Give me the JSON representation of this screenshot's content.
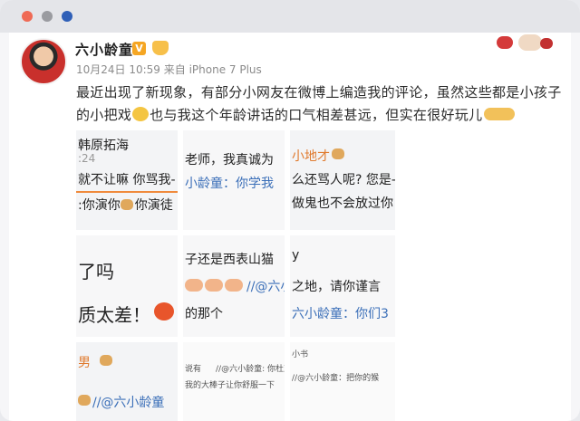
{
  "window": {
    "controls": [
      "close",
      "minimize",
      "maximize"
    ]
  },
  "post": {
    "username": "六小龄童",
    "verified_badge": "V",
    "meta": "10月24日 10:59 来自 iPhone 7 Plus",
    "text_line1": "最近出现了新现象，有部分小网友在微博上编造我的评论，虽然这些都是小孩子",
    "text_line2a": "的小把戏",
    "text_line2b": "也与我这个年龄讲话的口气相差甚远，但实在很好玩儿"
  },
  "tiles": {
    "t1": {
      "name": "韩原拓海",
      "time": ":24",
      "line1": "就不让嘛 你骂我-",
      "line2": ":你演你",
      "line2b": "你演徒"
    },
    "t2": {
      "line1": "老师，我真诚为",
      "line2": "小龄童：你学我"
    },
    "t3": {
      "name": "小地才",
      "line1": "么还骂人呢? 您是-",
      "line2": "做鬼也不会放过你"
    },
    "t4": {
      "line1": "了吗",
      "line2": "质太差！"
    },
    "t5": {
      "line1": "子还是西表山猫",
      "line2": "//@六小",
      "line3": "的那个"
    },
    "t6": {
      "line1": "y",
      "line2": "之地，请你谨言",
      "line3": "六小龄童：你们3"
    },
    "t7": {
      "name": "男",
      "line1": "//@六小龄童"
    },
    "t8": {
      "line1": "说有",
      "line1b": "//@六小龄童: 你杜对",
      "line2": "我的大棒子让你舒服一下"
    },
    "t9": {
      "line1": "小书",
      "line2": "//@六小龄童：把你的猴"
    }
  },
  "colors": {
    "accent": "#3b6fb8",
    "badge": "#f5a623",
    "close_dot": "#ef6a55"
  }
}
